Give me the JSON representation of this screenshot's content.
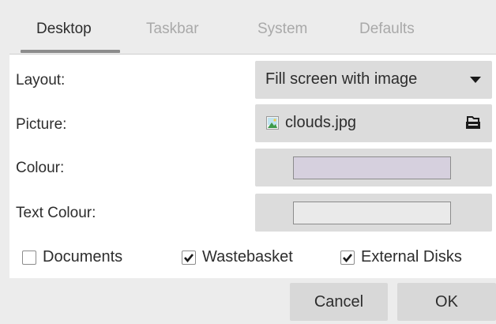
{
  "tabs": [
    {
      "label": "Desktop",
      "active": true
    },
    {
      "label": "Taskbar",
      "active": false
    },
    {
      "label": "System",
      "active": false
    },
    {
      "label": "Defaults",
      "active": false
    }
  ],
  "rows": {
    "layout": {
      "label": "Layout:",
      "value": "Fill screen with image"
    },
    "picture": {
      "label": "Picture:",
      "value": "clouds.jpg"
    },
    "colour": {
      "label": "Colour:",
      "swatch": "#d6d0de"
    },
    "text_colour": {
      "label": "Text Colour:",
      "swatch": "#eaeaea"
    }
  },
  "checkboxes": [
    {
      "label": "Documents",
      "checked": false
    },
    {
      "label": "Wastebasket",
      "checked": true
    },
    {
      "label": "External Disks",
      "checked": true
    }
  ],
  "buttons": {
    "cancel": "Cancel",
    "ok": "OK"
  },
  "icons": {
    "picture_file": "image-file-icon",
    "browse": "folder-open-icon",
    "dropdown": "dropdown-arrow-icon",
    "check": "checkmark-icon"
  }
}
